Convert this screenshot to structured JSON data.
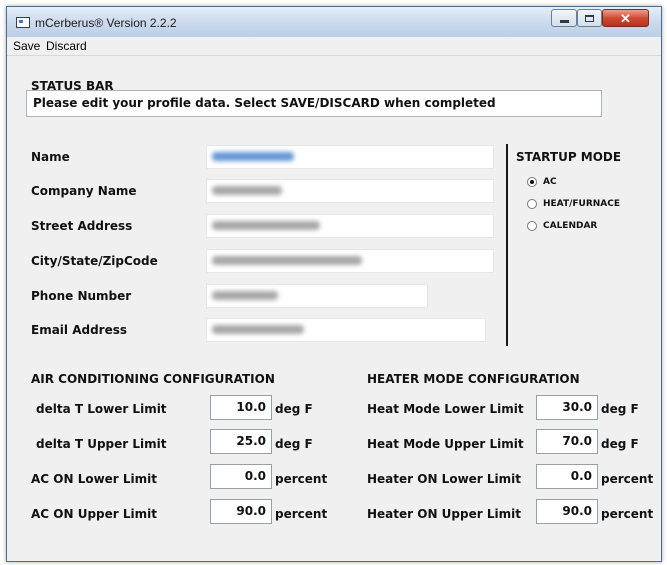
{
  "window": {
    "title": "mCerberus® Version 2.2.2"
  },
  "menu": {
    "save": "Save",
    "discard": "Discard"
  },
  "status": {
    "label": "STATUS BAR",
    "message": "Please edit your profile data. Select SAVE/DISCARD when completed"
  },
  "profile": {
    "name_label": "Name",
    "company_label": "Company Name",
    "street_label": "Street Address",
    "city_label": "City/State/ZipCode",
    "phone_label": "Phone Number",
    "email_label": "Email Address"
  },
  "startup": {
    "title": "STARTUP MODE",
    "options": [
      "AC",
      "HEAT/FURNACE",
      "CALENDAR"
    ],
    "selected": "AC"
  },
  "ac": {
    "title": "AIR CONDITIONING CONFIGURATION",
    "rows": [
      {
        "label": "delta T Lower Limit",
        "value": "10.0",
        "unit": "deg F"
      },
      {
        "label": "delta T Upper Limit",
        "value": "25.0",
        "unit": "deg F"
      },
      {
        "label": "AC ON Lower Limit",
        "value": "0.0",
        "unit": "percent"
      },
      {
        "label": "AC ON Upper Limit",
        "value": "90.0",
        "unit": "percent"
      }
    ]
  },
  "heater": {
    "title": "HEATER MODE CONFIGURATION",
    "rows": [
      {
        "label": "Heat Mode Lower Limit",
        "value": "30.0",
        "unit": "deg F"
      },
      {
        "label": "Heat Mode Upper Limit",
        "value": "70.0",
        "unit": "deg F"
      },
      {
        "label": "Heater ON Lower Limit",
        "value": "0.0",
        "unit": "percent"
      },
      {
        "label": "Heater ON Upper Limit",
        "value": "90.0",
        "unit": "percent"
      }
    ]
  },
  "icons": {
    "app": "app-window-icon",
    "minimize": "minimize-icon",
    "maximize": "maximize-icon",
    "close": "close-icon"
  },
  "colors": {
    "selection": "#3e7cc9",
    "close_button": "#cf4b33"
  }
}
